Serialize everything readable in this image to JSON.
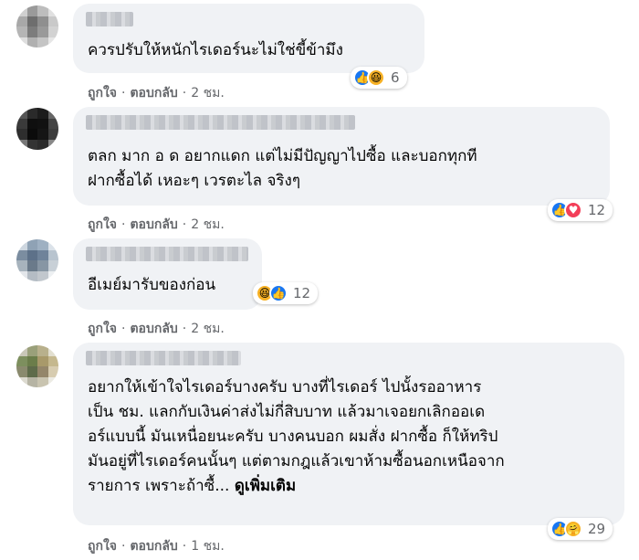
{
  "comments": [
    {
      "text_lines": [
        "ควรปรับให้หนักไรเดอร์นะไม่ใช่ขี้ข้ามึง"
      ],
      "reactions": [
        "like",
        "haha"
      ],
      "reaction_count": "6",
      "actions": {
        "like": "ถูกใจ",
        "reply": "ตอบกลับ",
        "time": "2 ชม."
      }
    },
    {
      "text_lines": [
        "ตลก มาก อ ด อยากแดก แต่ไม่มีปัญญาไปซื้อ และบอกทุกที",
        "ฝากซื้อได้ เหอะๆ เวรตะไล จริงๆ"
      ],
      "reactions": [
        "like",
        "love"
      ],
      "reaction_count": "12",
      "actions": {
        "like": "ถูกใจ",
        "reply": "ตอบกลับ",
        "time": "2 ชม."
      }
    },
    {
      "text_lines": [
        "อีเมย์มารับของก่อน"
      ],
      "reactions": [
        "haha",
        "like"
      ],
      "reaction_count": "12",
      "actions": {
        "like": "ถูกใจ",
        "reply": "ตอบกลับ",
        "time": "2 ชม."
      }
    },
    {
      "text_lines": [
        "อยากให้เข้าใจไรเดอร์บางครับ บางที่ไรเดอร์ ไปนั้งรออาหาร",
        "เป็น ชม. แลกกับเงินค่าส่งไม่กี่สิบบาท แล้วมาเจอยกเลิกออเด",
        "อร์แบบนี้ มันเหนื่อยนะครับ บางคนบอก ผมสั่ง ฝากซื้อ ก็ให้ทริป",
        "มันอยู่ที่ไรเดอร์คนนั้นๆ แต่ตามกฎแล้วเขาห้ามซื้อนอกเหนือจาก"
      ],
      "last_line": "รายการ เพราะถ้าซื้...",
      "see_more": "ดูเพิ่มเติม",
      "reactions": [
        "like",
        "care"
      ],
      "reaction_count": "29",
      "actions": {
        "like": "ถูกใจ",
        "reply": "ตอบกลับ",
        "time": "1 ชม."
      }
    }
  ],
  "colors": {
    "bubble": "#f0f2f5",
    "meta": "#65676b",
    "like": "#1877f2",
    "love": "#f33e58",
    "haha": "#f7b125"
  }
}
